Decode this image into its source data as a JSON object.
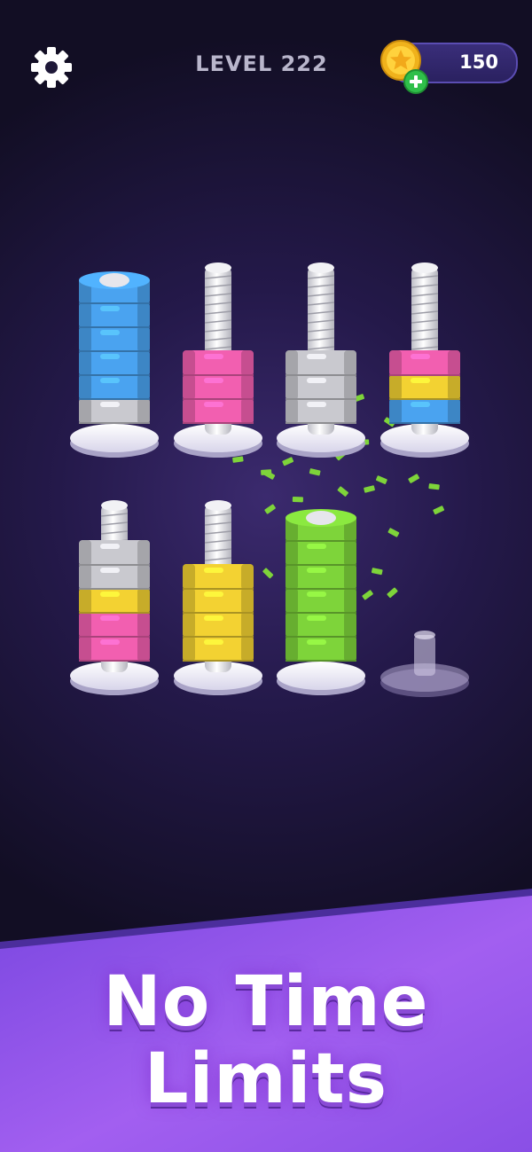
{
  "header": {
    "level_label": "LEVEL 222",
    "coins": "150",
    "settings_icon": "gear-icon",
    "coin_icon": "star-coin-icon",
    "add_coins_icon": "plus-icon"
  },
  "colors": {
    "blue": "#4aa3f0",
    "pink": "#f25fb0",
    "gray": "#c9c9cf",
    "yellow": "#f3d232",
    "green": "#7ed43a",
    "background": "#1c1538",
    "banner": "#8b4fe6"
  },
  "board": {
    "pegs": [
      {
        "nuts": [
          "gray",
          "blue",
          "blue",
          "blue",
          "blue",
          "blue"
        ],
        "bolt_capped": true
      },
      {
        "nuts": [
          "pink",
          "pink",
          "pink"
        ],
        "bolt_capped": false
      },
      {
        "nuts": [
          "gray",
          "gray",
          "gray"
        ],
        "bolt_capped": false
      },
      {
        "nuts": [
          "blue",
          "yellow",
          "pink"
        ],
        "bolt_capped": false
      },
      {
        "nuts": [
          "pink",
          "pink",
          "yellow",
          "gray",
          "gray"
        ],
        "bolt_capped": false
      },
      {
        "nuts": [
          "yellow",
          "yellow",
          "yellow",
          "yellow"
        ],
        "bolt_capped": false
      },
      {
        "nuts": [
          "green",
          "green",
          "green",
          "green",
          "green",
          "green"
        ],
        "bolt_capped": true
      },
      {
        "nuts": [],
        "bolt_capped": false,
        "locked": true
      }
    ]
  },
  "banner": {
    "line1": "No Time",
    "line2": "Limits"
  }
}
